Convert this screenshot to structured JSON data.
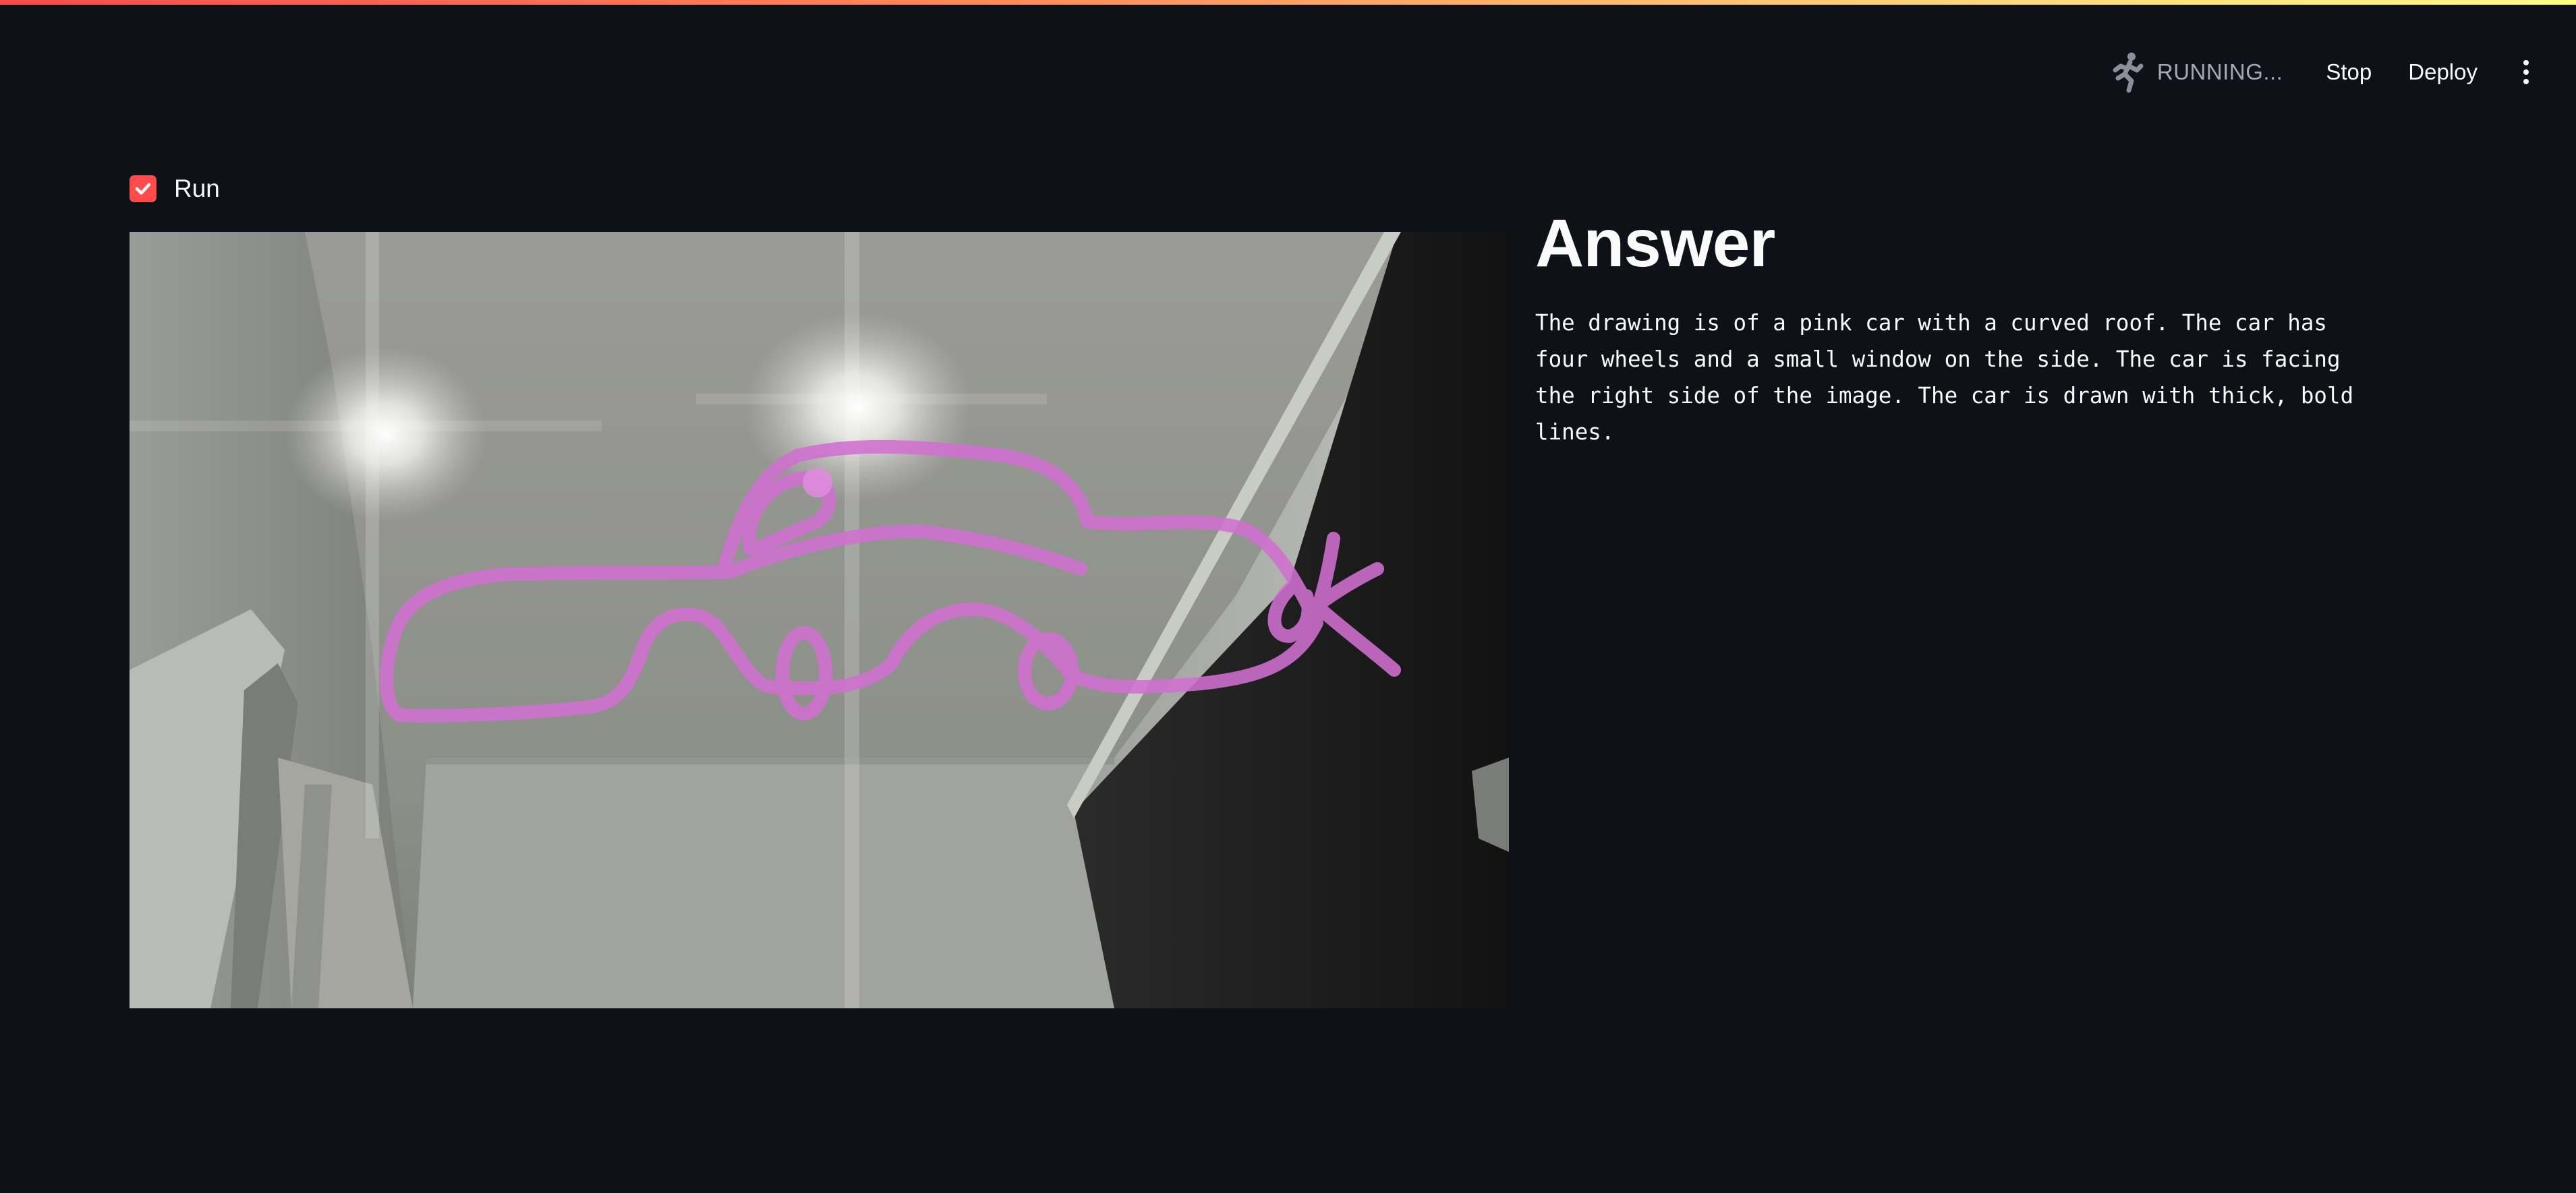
{
  "header": {
    "status_text": "RUNNING...",
    "stop_label": "Stop",
    "deploy_label": "Deploy",
    "status_icon": "running-man-icon",
    "menu_icon": "kebab-menu-icon"
  },
  "run_checkbox": {
    "label": "Run",
    "checked": true,
    "accent_color": "#ff4b4b"
  },
  "camera": {
    "description_icon": "webcam-feed"
  },
  "answer": {
    "title": "Answer",
    "body": "The drawing is of a pink car with a curved roof. The car has four wheels and a small window on the side. The car is facing the right side of the image. The car is drawn with thick, bold lines."
  },
  "theme": {
    "background": "#0e1117",
    "text": "#fafafa",
    "drawing_color": "#d070d0"
  }
}
